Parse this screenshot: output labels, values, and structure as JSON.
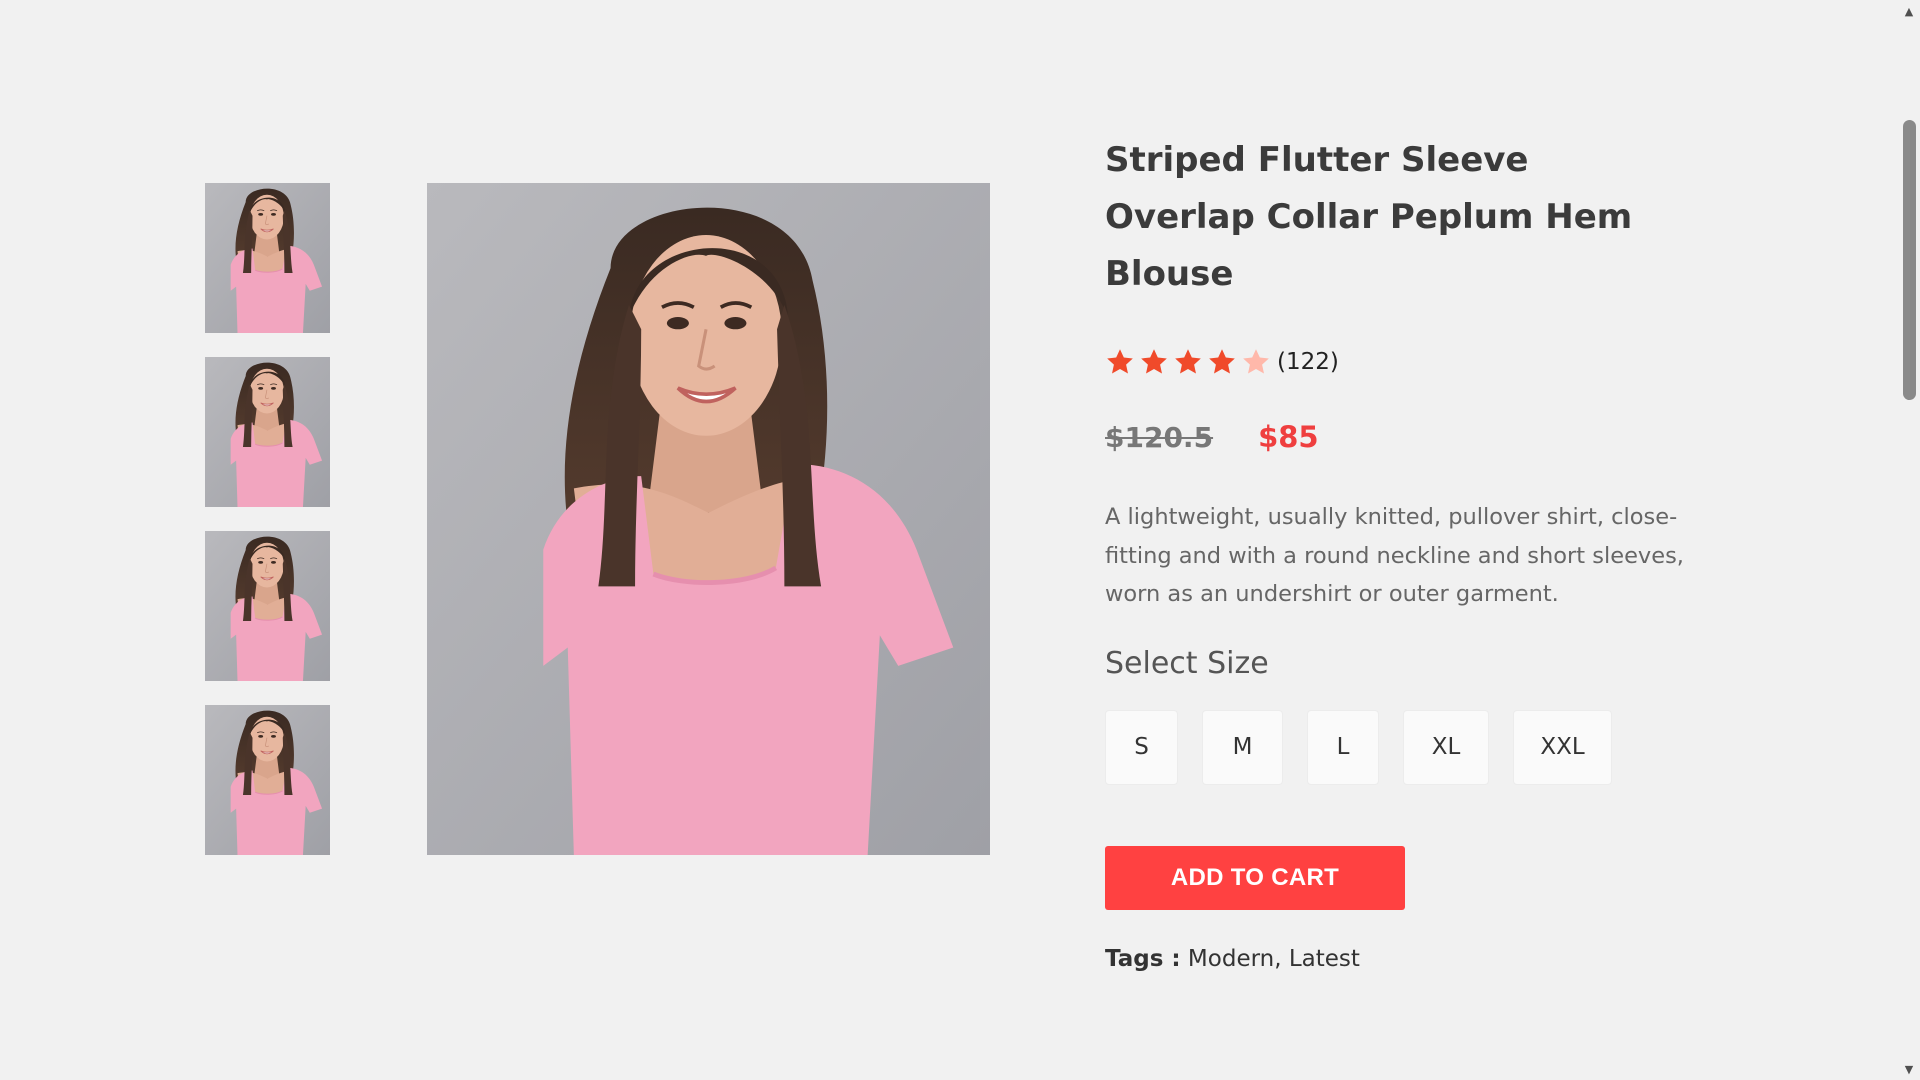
{
  "product": {
    "title": "Striped Flutter Sleeve Overlap Collar Peplum Hem Blouse",
    "rating": 4,
    "rating_max": 5,
    "review_count": "(122)",
    "old_price": "$120.5",
    "new_price": "$85",
    "description": "A lightweight, usually knitted, pullover shirt, close-fitting and with a round neckline and short sleeves, worn as an undershirt or outer garment.",
    "size_heading": "Select Size",
    "sizes": [
      "S",
      "M",
      "L",
      "XL",
      "XXL"
    ],
    "add_to_cart_label": "ADD TO CART",
    "tags_label": "Tags :",
    "tags_value": "Modern, Latest"
  },
  "gallery": {
    "thumbnail_count": 4,
    "image_alt": "Woman wearing pink square-neck top"
  },
  "colors": {
    "accent": "#ff4141",
    "price": "#ef3f3f",
    "star_filled": "#f04a2a",
    "star_empty": "#ffb8aa",
    "background": "#f1f1f1"
  },
  "icons": {
    "star": "star-icon",
    "scroll_up": "chevron-up-icon",
    "scroll_down": "chevron-down-icon"
  }
}
